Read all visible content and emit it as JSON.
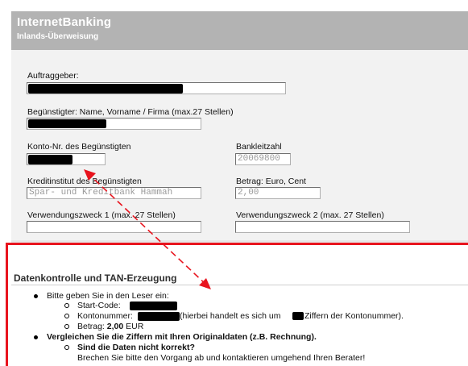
{
  "header": {
    "title": "InternetBanking",
    "subtitle": "Inlands-Überweisung"
  },
  "form": {
    "auftraggeber_label": "Auftraggeber:",
    "beguenstigter_label": "Begünstigter: Name, Vorname / Firma (max.27 Stellen)",
    "konto_label": "Konto-Nr. des Begünstigten",
    "blz_label": "Bankleitzahl",
    "blz_value": "20069800",
    "kreditinstitut_label": "Kreditinstitut des Begünstigten",
    "kreditinstitut_value": "Spar- und Kreditbank Hammah",
    "betrag_label": "Betrag: Euro, Cent",
    "betrag_value": "2,00",
    "vz1_label": "Verwendungszweck 1 (max. 27 Stellen)",
    "vz2_label": "Verwendungszweck 2 (max. 27 Stellen)"
  },
  "datenkontrolle": {
    "title": "Datenkontrolle und TAN-Erzeugung",
    "bullet1": "Bitte geben Sie in den Leser ein:",
    "startcode_label": "Start-Code:",
    "kontonummer_label": "Kontonummer:",
    "kontonummer_note_a": "(hierbei handelt es sich um",
    "kontonummer_note_b": "Ziffern der Kontonummer).",
    "betrag_label": "Betrag:",
    "betrag_value": "2,00",
    "betrag_currency": "EUR",
    "bullet2": "Vergleichen Sie die Ziffern mit Ihren Originaldaten (z.B. Rechnung).",
    "sub_question": "Sind die Daten nicht korrekt?",
    "sub_instruction": "Brechen Sie bitte den Vorgang ab und kontaktieren umgehend Ihren Berater!"
  },
  "colors": {
    "header_bg": "#b3b3b3",
    "panel_bg": "#f2f2f2",
    "highlight_red": "#e8141e"
  }
}
